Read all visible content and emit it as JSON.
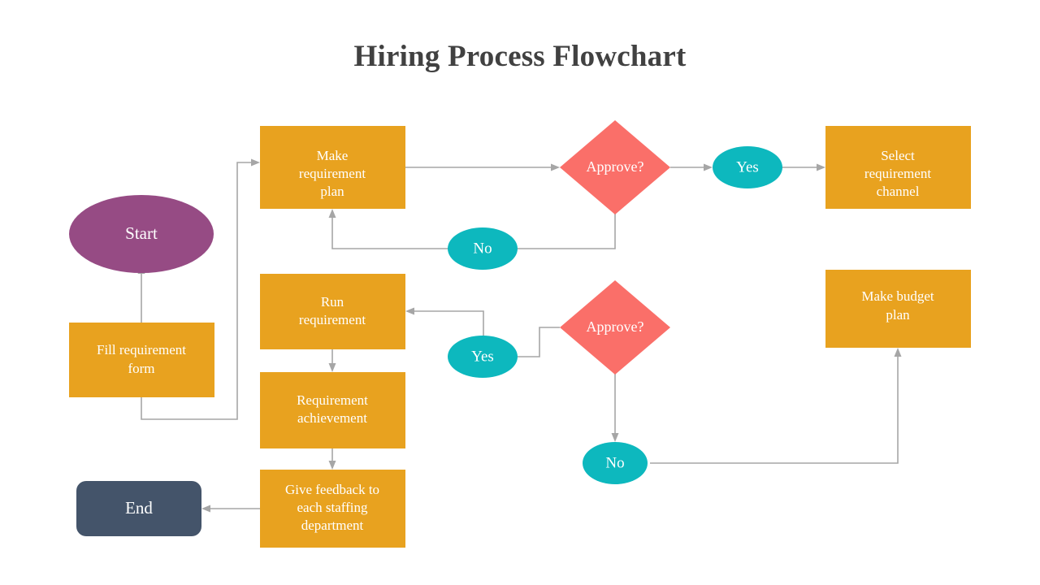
{
  "page": {
    "title": "Hiring Process Flowchart",
    "background": "#ffffff",
    "title_color": "#414141"
  },
  "palette": {
    "process": "#e8a21f",
    "decision": "#fa6f69",
    "yesno": "#0db8be",
    "start": "#964b84",
    "end": "#44546a",
    "connector": "#a6a6a6",
    "label_text": "#ffffff"
  },
  "nodes": {
    "start": {
      "label": "Start",
      "shape": "ellipse",
      "color": "#964b84"
    },
    "fill_form": {
      "label_line1": "Fill requirement",
      "label_line2": "form",
      "shape": "rect",
      "color": "#e8a21f"
    },
    "make_plan": {
      "label_line1": "Make",
      "label_line2": "requirement",
      "label_line3": "plan",
      "shape": "rect",
      "color": "#e8a21f"
    },
    "approve_1": {
      "label": "Approve?",
      "shape": "diamond",
      "color": "#fa6f69"
    },
    "yes_1": {
      "label": "Yes",
      "shape": "ellipse",
      "color": "#0db8be"
    },
    "select_channel": {
      "label_line1": "Select",
      "label_line2": "requirement",
      "label_line3": "channel",
      "shape": "rect",
      "color": "#e8a21f"
    },
    "no_1": {
      "label": "No",
      "shape": "ellipse",
      "color": "#0db8be"
    },
    "run_requirement": {
      "label_line1": "Run",
      "label_line2": "requirement",
      "shape": "rect",
      "color": "#e8a21f"
    },
    "approve_2": {
      "label": "Approve?",
      "shape": "diamond",
      "color": "#fa6f69"
    },
    "yes_2": {
      "label": "Yes",
      "shape": "ellipse",
      "color": "#0db8be"
    },
    "no_2": {
      "label": "No",
      "shape": "ellipse",
      "color": "#0db8be"
    },
    "budget_plan": {
      "label_line1": "Make budget",
      "label_line2": "plan",
      "shape": "rect",
      "color": "#e8a21f"
    },
    "achievement": {
      "label_line1": "Requirement",
      "label_line2": "achievement",
      "shape": "rect",
      "color": "#e8a21f"
    },
    "feedback": {
      "label_line1": "Give feedback to",
      "label_line2": "each staffing",
      "label_line3": "department",
      "shape": "rect",
      "color": "#e8a21f"
    },
    "end": {
      "label": "End",
      "shape": "rounded-rect",
      "color": "#44546a"
    }
  },
  "chart_data": {
    "type": "diagram",
    "title": "Hiring Process Flowchart",
    "diagram_kind": "flowchart",
    "steps": [
      "Fill requirement form",
      "Start",
      "Make requirement plan",
      "Approve?",
      "Yes",
      "Select requirement channel",
      "No",
      "Make budget plan",
      "Run requirement",
      "Requirement achievement",
      "Give feedback to each staffing department",
      "End"
    ],
    "edges": [
      {
        "from": "Fill requirement form",
        "to": "Start",
        "label": ""
      },
      {
        "from": "Fill requirement form",
        "to": "Make requirement plan",
        "label": ""
      },
      {
        "from": "Make requirement plan",
        "to": "Approve?",
        "label": ""
      },
      {
        "from": "Approve?",
        "to": "Yes",
        "label": "Yes"
      },
      {
        "from": "Yes",
        "to": "Select requirement channel",
        "label": ""
      },
      {
        "from": "Approve?",
        "to": "No",
        "label": "No"
      },
      {
        "from": "No",
        "to": "Make requirement plan",
        "label": ""
      },
      {
        "from": "Approve? (2)",
        "to": "Yes (2)",
        "label": "Yes"
      },
      {
        "from": "Yes (2)",
        "to": "Run requirement",
        "label": ""
      },
      {
        "from": "Approve? (2)",
        "to": "No (2)",
        "label": "No"
      },
      {
        "from": "No (2)",
        "to": "Make budget plan",
        "label": ""
      },
      {
        "from": "Run requirement",
        "to": "Requirement achievement",
        "label": ""
      },
      {
        "from": "Requirement achievement",
        "to": "Give feedback to each staffing department",
        "label": ""
      },
      {
        "from": "Give feedback to each staffing department",
        "to": "End",
        "label": ""
      }
    ]
  }
}
